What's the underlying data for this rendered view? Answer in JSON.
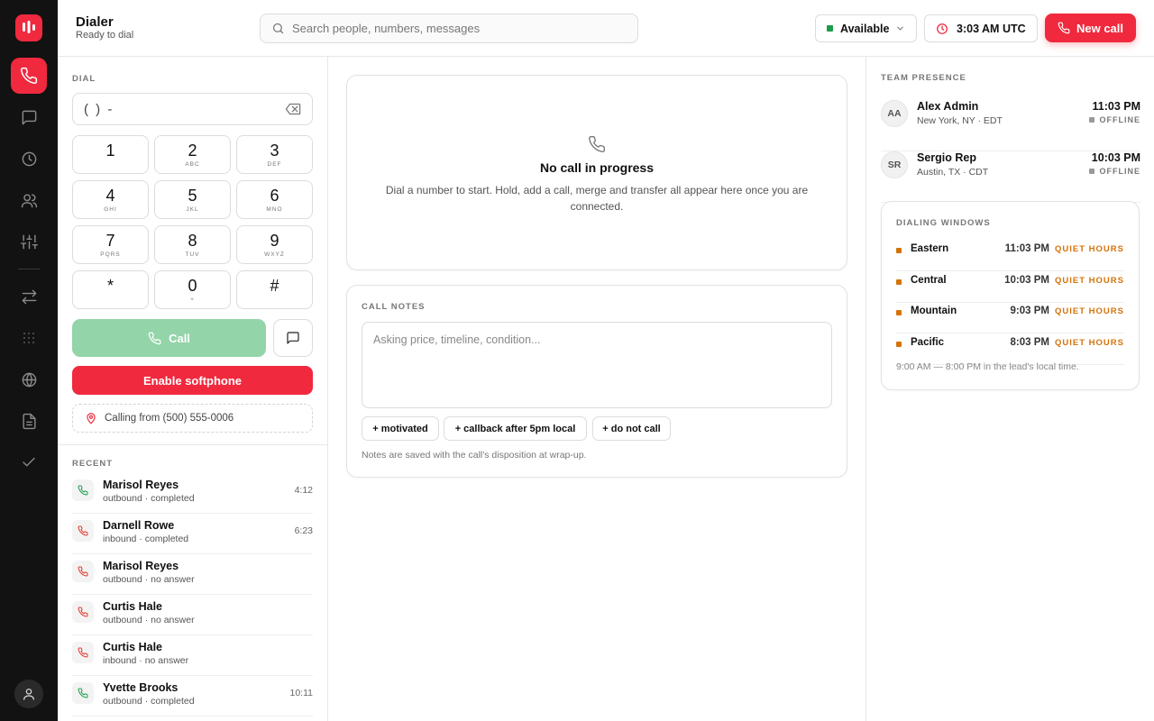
{
  "header": {
    "title": "Dialer",
    "subtitle": "Ready to dial",
    "search_placeholder": "Search people, numbers, messages",
    "status": "Available",
    "clock": "3:03 AM UTC",
    "new_call": "New call"
  },
  "rail": {
    "items": [
      "phone-icon",
      "message-icon",
      "clock-icon",
      "users-icon",
      "sliders-icon",
      "transfer-icon",
      "grid-icon",
      "globe-icon",
      "document-icon",
      "check-icon"
    ],
    "active": "phone-icon"
  },
  "dial": {
    "label": "DIAL",
    "input_value": "(  )  -",
    "keys": [
      {
        "d": "1",
        "l": ""
      },
      {
        "d": "2",
        "l": "ABC"
      },
      {
        "d": "3",
        "l": "DEF"
      },
      {
        "d": "4",
        "l": "GHI"
      },
      {
        "d": "5",
        "l": "JKL"
      },
      {
        "d": "6",
        "l": "MNO"
      },
      {
        "d": "7",
        "l": "PQRS"
      },
      {
        "d": "8",
        "l": "TUV"
      },
      {
        "d": "9",
        "l": "WXYZ"
      },
      {
        "d": "*",
        "l": ""
      },
      {
        "d": "0",
        "l": "+"
      },
      {
        "d": "#",
        "l": ""
      }
    ],
    "call_label": "Call",
    "softphone_label": "Enable softphone",
    "calling_from": "Calling from (500) 555-0006"
  },
  "recent": {
    "label": "RECENT",
    "items": [
      {
        "name": "Marisol Reyes",
        "meta": "outbound · completed",
        "duration": "4:12",
        "status": "completed"
      },
      {
        "name": "Darnell Rowe",
        "meta": "inbound · completed",
        "duration": "6:23",
        "status": "completed"
      },
      {
        "name": "Marisol Reyes",
        "meta": "outbound · no answer",
        "duration": "",
        "status": "no answer"
      },
      {
        "name": "Curtis Hale",
        "meta": "outbound · no answer",
        "duration": "",
        "status": "no answer"
      },
      {
        "name": "Curtis Hale",
        "meta": "inbound · no answer",
        "duration": "",
        "status": "no answer"
      },
      {
        "name": "Yvette Brooks",
        "meta": "outbound · completed",
        "duration": "10:11",
        "status": "completed"
      }
    ]
  },
  "call": {
    "title": "No call in progress",
    "description": "Dial a number to start. Hold, add a call, merge and transfer all appear here once you are connected."
  },
  "notes": {
    "label": "CALL NOTES",
    "placeholder": "Asking price, timeline, condition...",
    "chips": [
      "+ motivated",
      "+ callback after 5pm local",
      "+ do not call"
    ],
    "footer": "Notes are saved with the call's disposition at wrap-up."
  },
  "presence": {
    "label": "TEAM PRESENCE",
    "members": [
      {
        "initials": "AA",
        "name": "Alex Admin",
        "location": "New York, NY · EDT",
        "time": "11:03 PM",
        "status": "OFFLINE"
      },
      {
        "initials": "SR",
        "name": "Sergio Rep",
        "location": "Austin, TX · CDT",
        "time": "10:03 PM",
        "status": "OFFLINE"
      }
    ]
  },
  "windows": {
    "label": "DIALING WINDOWS",
    "rows": [
      {
        "zone": "Eastern",
        "time": "11:03 PM",
        "badge": "QUIET HOURS"
      },
      {
        "zone": "Central",
        "time": "10:03 PM",
        "badge": "QUIET HOURS"
      },
      {
        "zone": "Mountain",
        "time": "9:03 PM",
        "badge": "QUIET HOURS"
      },
      {
        "zone": "Pacific",
        "time": "8:03 PM",
        "badge": "QUIET HOURS"
      }
    ],
    "footer": "9:00 AM — 8:00 PM in the lead's local time."
  },
  "colors": {
    "accent": "#f0293e",
    "rail": "#121212",
    "call_disabled": "#93d4a9",
    "available": "#1c9c4a",
    "quiet_hours": "#d4730a"
  }
}
